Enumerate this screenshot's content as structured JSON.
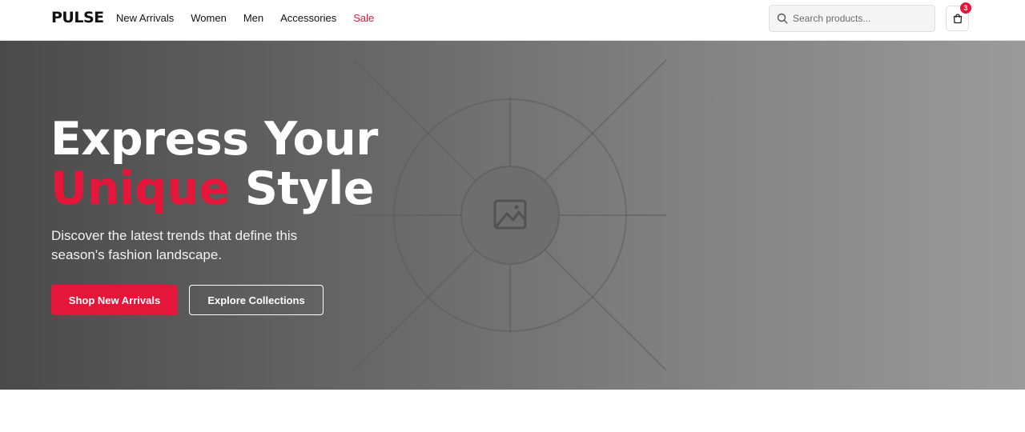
{
  "brand": {
    "logo_text": "PULSE"
  },
  "nav": {
    "items": [
      {
        "label": "New Arrivals"
      },
      {
        "label": "Women"
      },
      {
        "label": "Men"
      },
      {
        "label": "Accessories"
      },
      {
        "label": "Sale",
        "highlight": true
      }
    ]
  },
  "search": {
    "placeholder": "Search products...",
    "value": "",
    "icon": "search-icon"
  },
  "cart": {
    "icon": "shopping-bag-icon",
    "count": "3"
  },
  "hero": {
    "title_line1": "Express Your",
    "title_accent": "Unique",
    "title_rest": "Style",
    "subtitle": "Discover the latest trends that define this season's fashion landscape.",
    "primary_cta": "Shop New Arrivals",
    "secondary_cta": "Explore Collections",
    "image_placeholder_icon": "image-placeholder-icon"
  },
  "colors": {
    "accent": "#e4163a",
    "text": "#111111",
    "hero_gradient_start": "#4a4a4a",
    "hero_gradient_end": "#9a9a9a"
  }
}
